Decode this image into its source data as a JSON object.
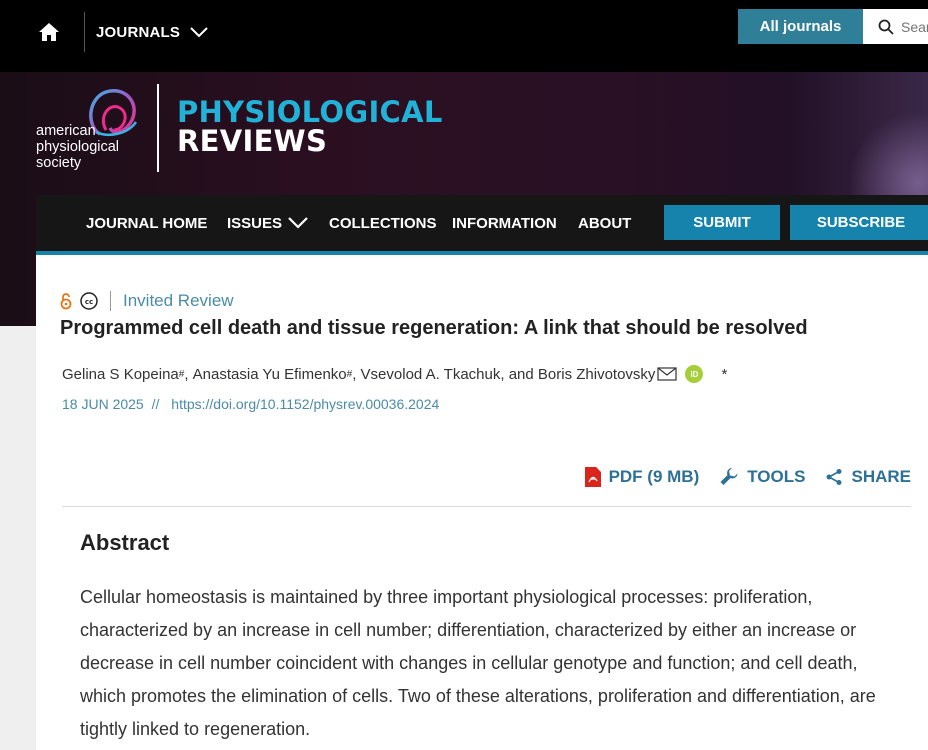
{
  "topbar": {
    "journals_label": "JOURNALS",
    "all_journals_label": "All journals",
    "search_placeholder": "Search"
  },
  "branding": {
    "society_lines": [
      "american",
      "physiological",
      "society"
    ],
    "journal_line1": "PHYSIOLOGICAL",
    "journal_line2": "REVIEWS"
  },
  "nav": {
    "items": [
      "JOURNAL HOME",
      "ISSUES",
      "COLLECTIONS",
      "INFORMATION",
      "ABOUT"
    ],
    "submit": "SUBMIT",
    "subscribe": "SUBSCRIBE"
  },
  "article": {
    "type": "Invited Review",
    "title": "Programmed cell death and tissue regeneration: A link that should be resolved",
    "authors": [
      {
        "name": "Gelina S Kopeina",
        "mark": "#"
      },
      {
        "name": "Anastasia Yu Efimenko",
        "mark": "#"
      },
      {
        "name": "Vsevolod A. Tkachuk"
      },
      {
        "name": "Boris Zhivotovsky"
      }
    ],
    "authors_joiner": ", and ",
    "author_note": "*",
    "date": "18 JUN 2025",
    "separator": "//",
    "doi": "https://doi.org/10.1152/physrev.00036.2024"
  },
  "tools": {
    "pdf": "PDF (9 MB)",
    "tools": "TOOLS",
    "share": "SHARE"
  },
  "abstract": {
    "heading": "Abstract",
    "text": "Cellular homeostasis is maintained by three important physiological processes: proliferation, characterized by an increase in cell number; differentiation, characterized by either an increase or decrease in cell number coincident with changes in cellular genotype and function; and cell death, which promotes the elimination of cells. Two of these alterations, proliferation and differentiation, are tightly linked to regeneration."
  },
  "colors": {
    "accent": "#1583ab",
    "journal_cyan": "#22b2d8",
    "link": "#4b8ba8"
  }
}
